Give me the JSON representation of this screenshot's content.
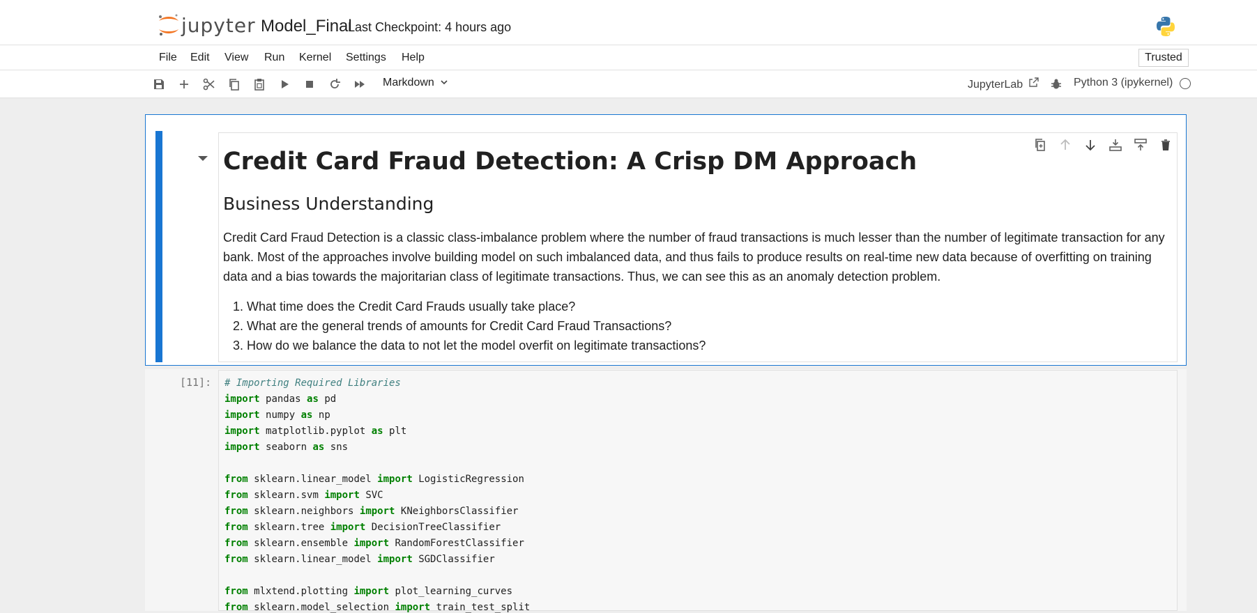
{
  "header": {
    "logo_text": "jupyter",
    "notebook_title": "Model_Final",
    "checkpoint": "Last Checkpoint: 4 hours ago"
  },
  "menu": {
    "items": [
      "File",
      "Edit",
      "View",
      "Run",
      "Kernel",
      "Settings",
      "Help"
    ],
    "trusted": "Trusted"
  },
  "toolbar": {
    "buttons": [
      "save-icon",
      "plus-icon",
      "scissors-icon",
      "copy-icon",
      "paste-icon",
      "play-icon",
      "stop-icon",
      "restart-icon",
      "fast-forward-icon"
    ],
    "cell_type": "Markdown",
    "jupyterlab_link": "JupyterLab",
    "kernel_name": "Python 3 (ipykernel)"
  },
  "markdown_cell": {
    "h1": "Credit Card Fraud Detection: A Crisp DM Approach",
    "h2": "Business Understanding",
    "paragraph": "Credit Card Fraud Detection is a classic class-imbalance problem where the number of fraud transactions is much lesser than the number of legitimate transaction for any bank. Most of the approaches involve building model on such imbalanced data, and thus fails to produce results on real-time new data because of overfitting on training data and a bias towards the majoritarian class of legitimate transactions. Thus, we can see this as an anomaly detection problem.",
    "questions": [
      "What time does the Credit Card Frauds usually take place?",
      "What are the general trends of amounts for Credit Card Fraud Transactions?",
      "How do we balance the data to not let the model overfit on legitimate transactions?"
    ],
    "actions": [
      "duplicate-icon",
      "move-up-icon",
      "move-down-icon",
      "insert-below-icon",
      "insert-above-icon",
      "delete-icon"
    ]
  },
  "code_cell": {
    "prompt": "[11]:",
    "lines": [
      "# Importing Required Libraries",
      "import pandas as pd",
      "import numpy as np",
      "import matplotlib.pyplot as plt",
      "import seaborn as sns",
      "",
      "from sklearn.linear_model import LogisticRegression",
      "from sklearn.svm import SVC",
      "from sklearn.neighbors import KNeighborsClassifier",
      "from sklearn.tree import DecisionTreeClassifier",
      "from sklearn.ensemble import RandomForestClassifier",
      "from sklearn.linear_model import SGDClassifier",
      "",
      "from mlxtend.plotting import plot_learning_curves",
      "from sklearn.model_selection import train_test_split"
    ]
  },
  "colors": {
    "accent": "#1976d2",
    "keyword": "#008000",
    "comment": "#408080",
    "jupyter_orange": "#f37726"
  }
}
